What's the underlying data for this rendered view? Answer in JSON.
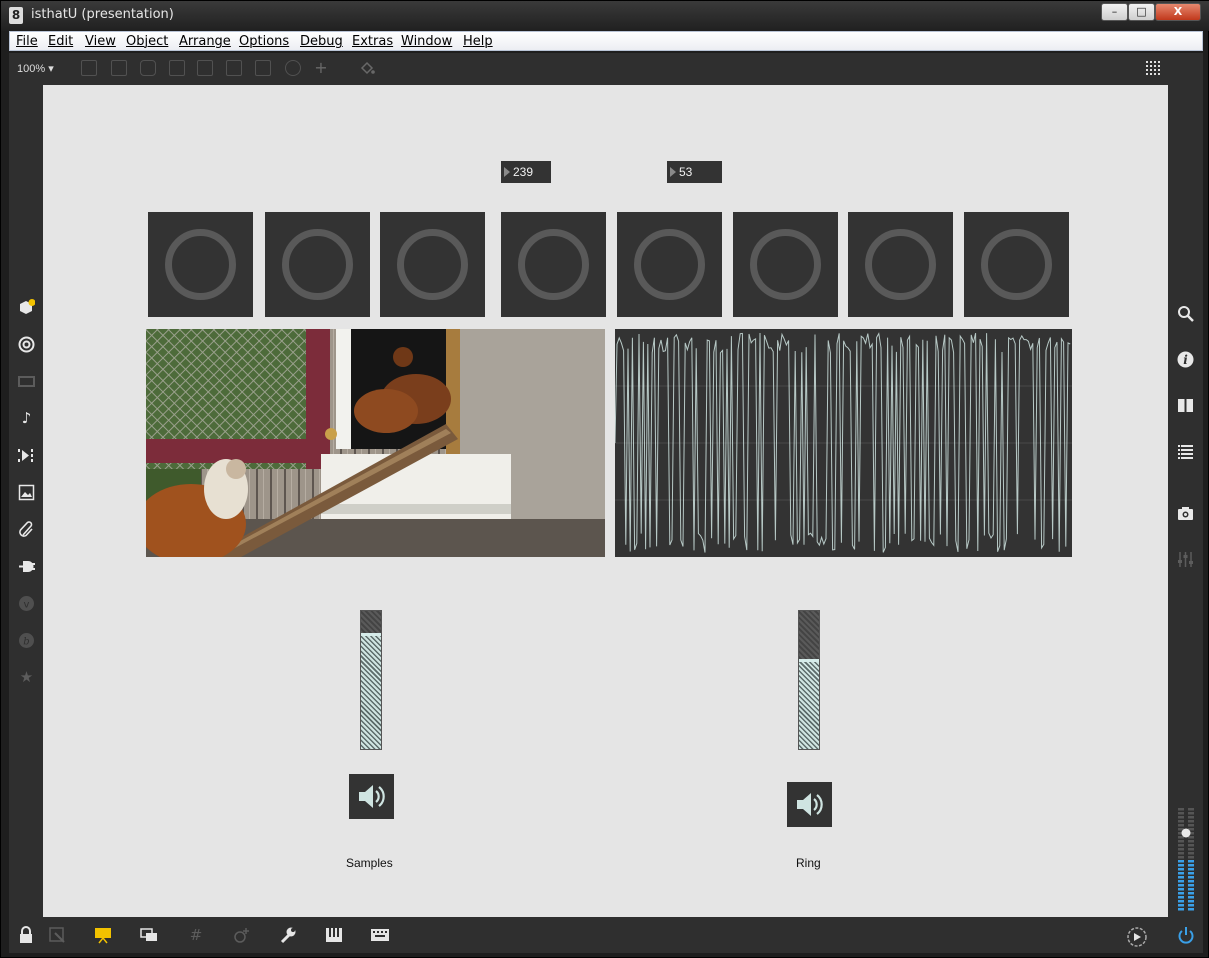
{
  "window": {
    "title": "isthatU (presentation)",
    "app_glyph": "8",
    "buttons": {
      "minimize": "–",
      "maximize": "□",
      "close": "X"
    }
  },
  "menu": [
    "File",
    "Edit",
    "View",
    "Object",
    "Arrange",
    "Options",
    "Debug",
    "Extras",
    "Window",
    "Help"
  ],
  "toolbar": {
    "zoom": "100%",
    "zoom_arrow": "▾",
    "icons": [
      "presentation-toggle-icon",
      "message-icon",
      "comment-icon",
      "toggle-icon",
      "button-icon",
      "number-box-icon",
      "slider-icon",
      "dial-icon",
      "plus-icon",
      "paint-bucket-icon",
      "grid-icon"
    ]
  },
  "left_sidebar": {
    "icons": [
      "package-icon",
      "target-icon",
      "bpatcher-icon",
      "music-note-icon",
      "playlist-icon",
      "image-icon",
      "paperclip-icon",
      "plug-icon",
      "vst-icon",
      "b-icon",
      "star-icon"
    ]
  },
  "right_sidebar": {
    "icons": [
      "search-icon",
      "info-icon",
      "split-view-icon",
      "list-icon",
      "snapshot-icon",
      "mixer-icon"
    ]
  },
  "canvas": {
    "number_boxes": [
      {
        "value": "239"
      },
      {
        "value": "53"
      }
    ],
    "pads_count": 8,
    "channels": [
      {
        "label": "Samples",
        "gain_level": 0.84
      },
      {
        "label": "Ring",
        "gain_level": 0.65
      }
    ]
  },
  "colors": {
    "canvas_bg": "#e5e5e5",
    "object_bg": "#333333",
    "ring": "#595959",
    "scope_trace": "#cfe4e1",
    "meter_blue": "#3aa0e8",
    "accent_yellow": "#f2c200"
  },
  "bottom_bar": {
    "icons": [
      "lock-icon",
      "edit-mode-icon",
      "presentation-icon",
      "windows-icon",
      "grid-icon",
      "add-icon",
      "wrench-icon",
      "piano-icon",
      "keyboard-icon",
      "transport-icon",
      "power-icon"
    ]
  }
}
